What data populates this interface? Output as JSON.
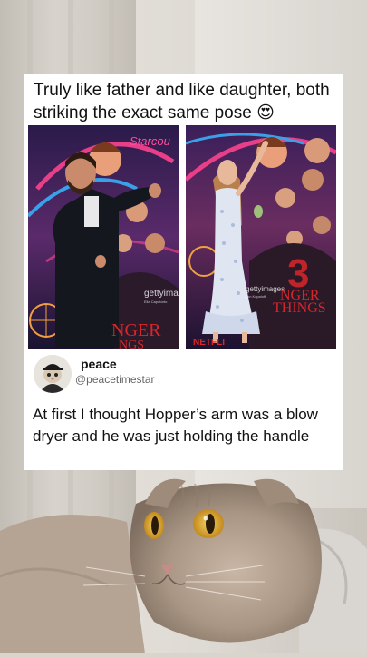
{
  "post": {
    "caption": "Truly like father and like daughter, both striking the exact same pose",
    "caption_emoji": "😍"
  },
  "photos": [
    {
      "watermark": "gettyima",
      "credit": "Elia Capotorto",
      "poster_text_top": "Starcou",
      "poster_text_bottom": "NGER",
      "poster_text_bottom2": "NGS"
    },
    {
      "watermark": "gettyimages",
      "credit": "Jon Kopaloff",
      "poster_text_bottom": "NGER",
      "poster_text_bottom2": "THINGS",
      "poster_number": "3",
      "sponsor": "NETFLI"
    }
  ],
  "tweet": {
    "name": "peace",
    "handle": "@peacetimestar",
    "body": "At first I thought Hopper’s arm was a blow dryer and he was just holding the handle"
  },
  "colors": {
    "card_bg": "#ffffff",
    "text": "#111111",
    "handle": "#666666",
    "poster_neon_pink": "#e83f88",
    "poster_neon_blue": "#3aa0e8"
  }
}
